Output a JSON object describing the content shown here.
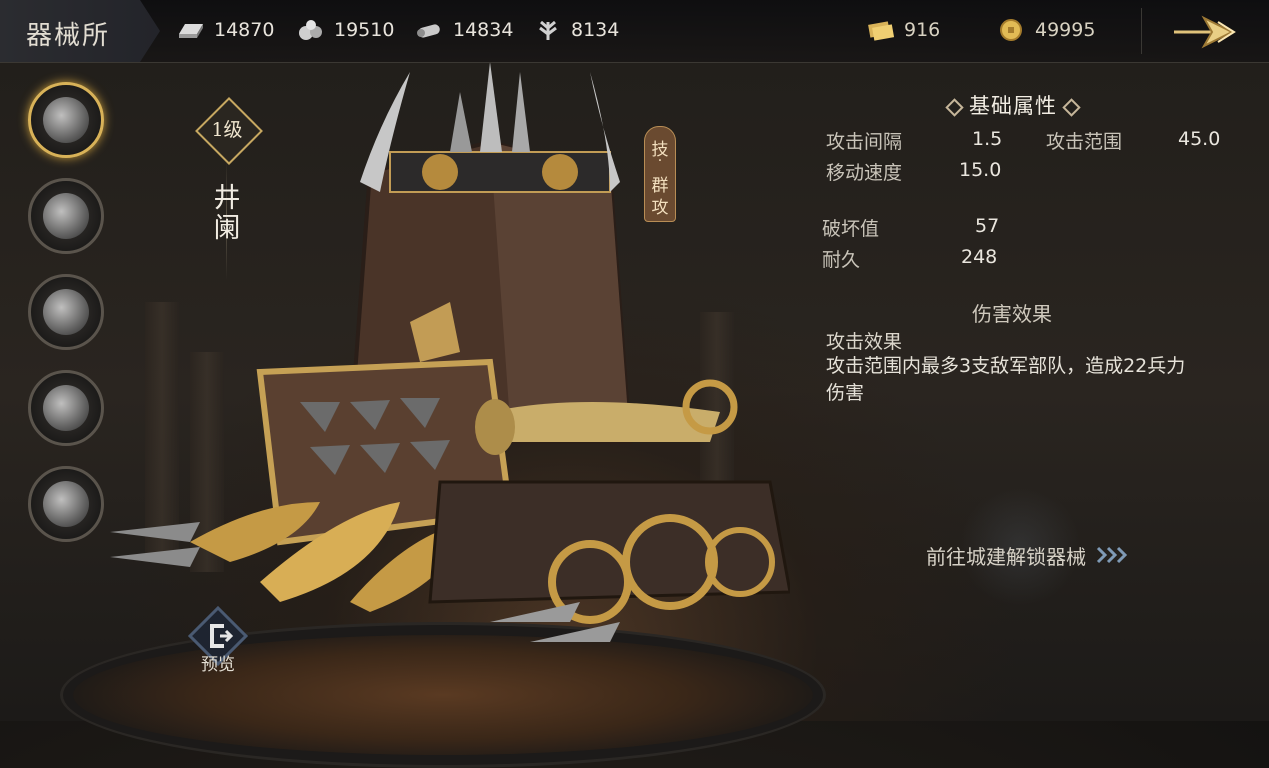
{
  "header": {
    "title": "器械所",
    "resources": [
      {
        "icon": "iron-ingot-icon",
        "value": "14870"
      },
      {
        "icon": "stone-pile-icon",
        "value": "19510"
      },
      {
        "icon": "wood-log-icon",
        "value": "14834"
      },
      {
        "icon": "grain-icon",
        "value": "8134"
      }
    ],
    "currencies": [
      {
        "icon": "gold-tickets-icon",
        "value": "916"
      },
      {
        "icon": "gold-coin-icon",
        "value": "49995"
      }
    ],
    "exit_icon": "arrow-right-icon"
  },
  "side_menu": {
    "items": [
      {
        "icon": "tower-machine-icon",
        "active": true
      },
      {
        "icon": "catapult-icon",
        "active": false
      },
      {
        "icon": "ram-icon",
        "active": false
      },
      {
        "icon": "skull-shield-icon",
        "active": false
      },
      {
        "icon": "siege-tower-icon",
        "active": false
      }
    ]
  },
  "unit": {
    "level": "1级",
    "name": "井阑",
    "skill_tag_top": "技",
    "skill_tag_sep": "·",
    "skill_tag_bottom_1": "群",
    "skill_tag_bottom_2": "攻",
    "preview_label": "预览"
  },
  "stats": {
    "header": "基础属性",
    "attack_interval_label": "攻击间隔",
    "attack_interval_value": "1.5",
    "attack_range_label": "攻击范围",
    "attack_range_value": "45.0",
    "move_speed_label": "移动速度",
    "move_speed_value": "15.0",
    "destroy_label": "破坏值",
    "destroy_value": "57",
    "durability_label": "耐久",
    "durability_value": "248",
    "damage_header": "伤害效果",
    "effect_title": "攻击效果",
    "effect_desc": "攻击范围内最多3支敌军部队，造成22兵力伤害"
  },
  "goto": {
    "label": "前往城建解锁器械",
    "icon": "triple-chevron-right-icon"
  },
  "colors": {
    "accent_gold": "#d8b258",
    "text_light": "#eae6de",
    "skill_tag_bg": "#6a4a30"
  }
}
